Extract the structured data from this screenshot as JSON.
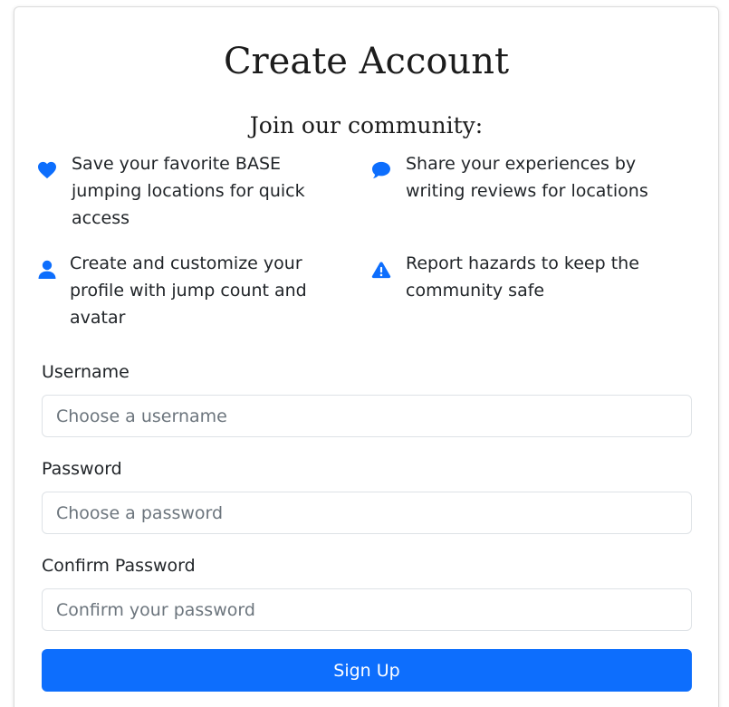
{
  "page": {
    "title": "Create Account",
    "subtitle": "Join our community:"
  },
  "features": [
    {
      "icon": "heart-icon",
      "text": "Save your favorite BASE jumping locations for quick access"
    },
    {
      "icon": "speech-bubble-icon",
      "text": "Share your experiences by writing reviews for locations"
    },
    {
      "icon": "user-icon",
      "text": "Create and customize your profile with jump count and avatar"
    },
    {
      "icon": "warning-triangle-icon",
      "text": "Report hazards to keep the community safe"
    }
  ],
  "form": {
    "username": {
      "label": "Username",
      "placeholder": "Choose a username",
      "value": ""
    },
    "password": {
      "label": "Password",
      "placeholder": "Choose a password",
      "value": ""
    },
    "confirm_password": {
      "label": "Confirm Password",
      "placeholder": "Confirm your password",
      "value": ""
    },
    "submit_label": "Sign Up"
  },
  "colors": {
    "accent": "#0d6efd",
    "icon": "#0d6efd",
    "text": "#212529",
    "placeholder": "#6c757d",
    "border": "#dee2e6"
  }
}
